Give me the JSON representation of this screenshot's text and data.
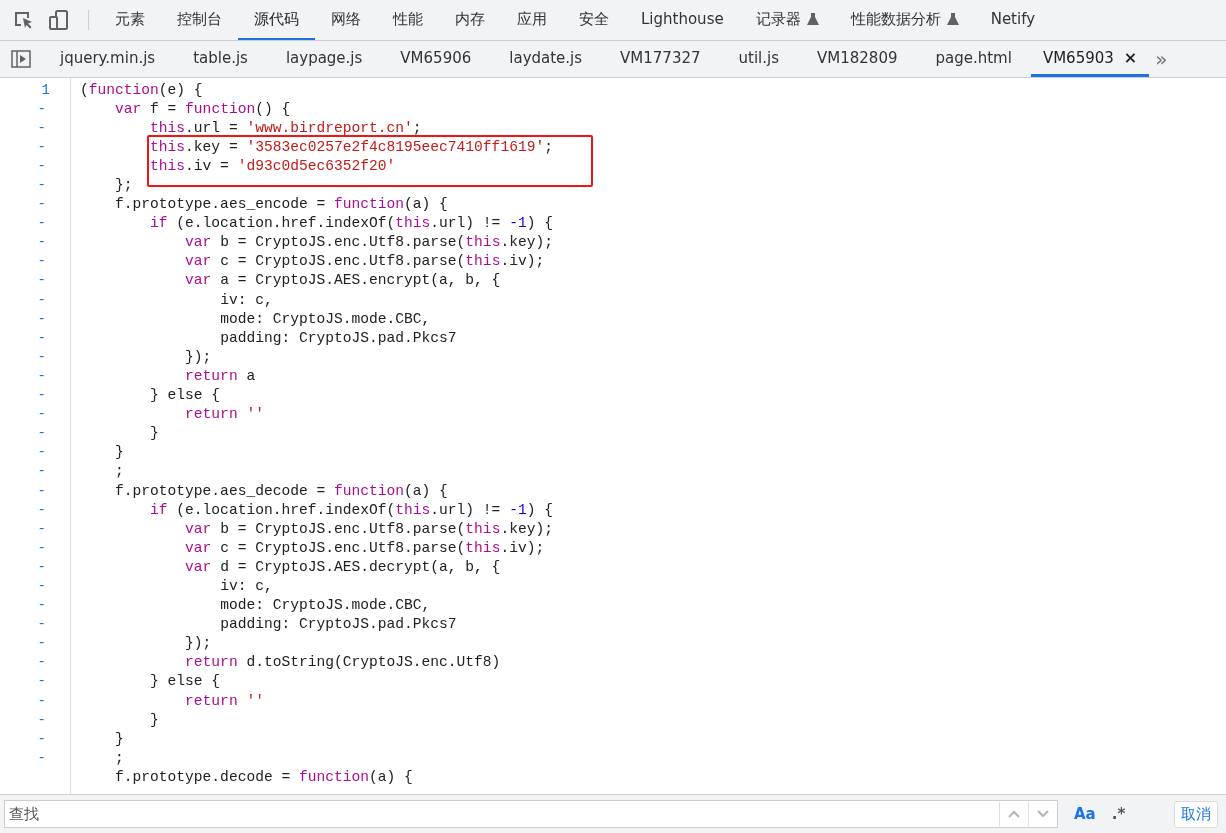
{
  "main_tabs": [
    {
      "label": "元素",
      "selected": false,
      "experimental": false
    },
    {
      "label": "控制台",
      "selected": false,
      "experimental": false
    },
    {
      "label": "源代码",
      "selected": true,
      "experimental": false
    },
    {
      "label": "网络",
      "selected": false,
      "experimental": false
    },
    {
      "label": "性能",
      "selected": false,
      "experimental": false
    },
    {
      "label": "内存",
      "selected": false,
      "experimental": false
    },
    {
      "label": "应用",
      "selected": false,
      "experimental": false
    },
    {
      "label": "安全",
      "selected": false,
      "experimental": false
    },
    {
      "label": "Lighthouse",
      "selected": false,
      "experimental": false
    },
    {
      "label": "记录器",
      "selected": false,
      "experimental": true
    },
    {
      "label": "性能数据分析",
      "selected": false,
      "experimental": true
    },
    {
      "label": "Netify",
      "selected": false,
      "experimental": false
    }
  ],
  "file_tabs": [
    {
      "label": "jquery.min.js",
      "selected": false
    },
    {
      "label": "table.js",
      "selected": false
    },
    {
      "label": "laypage.js",
      "selected": false
    },
    {
      "label": "VM65906",
      "selected": false
    },
    {
      "label": "laydate.js",
      "selected": false
    },
    {
      "label": "VM177327",
      "selected": false
    },
    {
      "label": "util.js",
      "selected": false
    },
    {
      "label": "VM182809",
      "selected": false
    },
    {
      "label": "page.html",
      "selected": false
    },
    {
      "label": "VM65903",
      "selected": true,
      "close": "×"
    }
  ],
  "overflow": "»",
  "code_lines": [
    {
      "gutter": "1",
      "segments": [
        {
          "kind": "plain",
          "text": "("
        },
        {
          "kind": "keyword",
          "text": "function"
        },
        {
          "kind": "plain",
          "text": "(e) {"
        }
      ]
    },
    {
      "gutter": "-",
      "segments": [
        {
          "kind": "keyword",
          "text": "    var"
        },
        {
          "kind": "plain",
          "text": " f = "
        },
        {
          "kind": "keyword",
          "text": "function"
        },
        {
          "kind": "plain",
          "text": "() {"
        }
      ]
    },
    {
      "gutter": "-",
      "segments": [
        {
          "kind": "keyword",
          "text": "        this"
        },
        {
          "kind": "plain",
          "text": ".url = "
        },
        {
          "kind": "string",
          "text": "'www.birdreport.cn'"
        },
        {
          "kind": "plain",
          "text": ";"
        }
      ]
    },
    {
      "gutter": "-",
      "boxed": true,
      "segments": [
        {
          "kind": "keyword",
          "text": "        this"
        },
        {
          "kind": "plain",
          "text": ".key = "
        },
        {
          "kind": "string",
          "text": "'3583ec0257e2f4c8195eec7410ff1619'"
        },
        {
          "kind": "plain",
          "text": ";"
        }
      ]
    },
    {
      "gutter": "-",
      "boxed": true,
      "segments": [
        {
          "kind": "keyword",
          "text": "        this"
        },
        {
          "kind": "plain",
          "text": ".iv = "
        },
        {
          "kind": "string",
          "text": "'d93c0d5ec6352f20'"
        }
      ]
    },
    {
      "gutter": "-",
      "segments": [
        {
          "kind": "plain",
          "text": "    };"
        }
      ]
    },
    {
      "gutter": "-",
      "segments": [
        {
          "kind": "plain",
          "text": "    f.prototype.aes_encode = "
        },
        {
          "kind": "keyword",
          "text": "function"
        },
        {
          "kind": "plain",
          "text": "(a) {"
        }
      ]
    },
    {
      "gutter": "-",
      "segments": [
        {
          "kind": "keyword",
          "text": "        if"
        },
        {
          "kind": "plain",
          "text": " (e.location.href.indexOf("
        },
        {
          "kind": "keyword",
          "text": "this"
        },
        {
          "kind": "plain",
          "text": ".url) != "
        },
        {
          "kind": "number",
          "text": "-1"
        },
        {
          "kind": "plain",
          "text": ") {"
        }
      ]
    },
    {
      "gutter": "-",
      "segments": [
        {
          "kind": "keyword",
          "text": "            var"
        },
        {
          "kind": "plain",
          "text": " b = CryptoJS.enc.Utf8.parse("
        },
        {
          "kind": "keyword",
          "text": "this"
        },
        {
          "kind": "plain",
          "text": ".key);"
        }
      ]
    },
    {
      "gutter": "-",
      "segments": [
        {
          "kind": "keyword",
          "text": "            var"
        },
        {
          "kind": "plain",
          "text": " c = CryptoJS.enc.Utf8.parse("
        },
        {
          "kind": "keyword",
          "text": "this"
        },
        {
          "kind": "plain",
          "text": ".iv);"
        }
      ]
    },
    {
      "gutter": "-",
      "segments": [
        {
          "kind": "keyword",
          "text": "            var"
        },
        {
          "kind": "plain",
          "text": " a = CryptoJS.AES.encrypt(a, b, {"
        }
      ]
    },
    {
      "gutter": "-",
      "segments": [
        {
          "kind": "plain",
          "text": "                iv: c,"
        }
      ]
    },
    {
      "gutter": "-",
      "segments": [
        {
          "kind": "plain",
          "text": "                mode: CryptoJS.mode.CBC,"
        }
      ]
    },
    {
      "gutter": "-",
      "segments": [
        {
          "kind": "plain",
          "text": "                padding: CryptoJS.pad.Pkcs7"
        }
      ]
    },
    {
      "gutter": "-",
      "segments": [
        {
          "kind": "plain",
          "text": "            });"
        }
      ]
    },
    {
      "gutter": "-",
      "segments": [
        {
          "kind": "keyword",
          "text": "            return"
        },
        {
          "kind": "plain",
          "text": " a"
        }
      ]
    },
    {
      "gutter": "-",
      "segments": [
        {
          "kind": "plain",
          "text": "        } else {"
        }
      ]
    },
    {
      "gutter": "-",
      "segments": [
        {
          "kind": "keyword",
          "text": "            return"
        },
        {
          "kind": "string",
          "text": " ''"
        }
      ]
    },
    {
      "gutter": "-",
      "segments": [
        {
          "kind": "plain",
          "text": "        }"
        }
      ]
    },
    {
      "gutter": "-",
      "segments": [
        {
          "kind": "plain",
          "text": "    }"
        }
      ]
    },
    {
      "gutter": "-",
      "segments": [
        {
          "kind": "plain",
          "text": "    ;"
        }
      ]
    },
    {
      "gutter": "-",
      "segments": [
        {
          "kind": "plain",
          "text": "    f.prototype.aes_decode = "
        },
        {
          "kind": "keyword",
          "text": "function"
        },
        {
          "kind": "plain",
          "text": "(a) {"
        }
      ]
    },
    {
      "gutter": "-",
      "segments": [
        {
          "kind": "keyword",
          "text": "        if"
        },
        {
          "kind": "plain",
          "text": " (e.location.href.indexOf("
        },
        {
          "kind": "keyword",
          "text": "this"
        },
        {
          "kind": "plain",
          "text": ".url) != "
        },
        {
          "kind": "number",
          "text": "-1"
        },
        {
          "kind": "plain",
          "text": ") {"
        }
      ]
    },
    {
      "gutter": "-",
      "segments": [
        {
          "kind": "keyword",
          "text": "            var"
        },
        {
          "kind": "plain",
          "text": " b = CryptoJS.enc.Utf8.parse("
        },
        {
          "kind": "keyword",
          "text": "this"
        },
        {
          "kind": "plain",
          "text": ".key);"
        }
      ]
    },
    {
      "gutter": "-",
      "segments": [
        {
          "kind": "keyword",
          "text": "            var"
        },
        {
          "kind": "plain",
          "text": " c = CryptoJS.enc.Utf8.parse("
        },
        {
          "kind": "keyword",
          "text": "this"
        },
        {
          "kind": "plain",
          "text": ".iv);"
        }
      ]
    },
    {
      "gutter": "-",
      "segments": [
        {
          "kind": "keyword",
          "text": "            var"
        },
        {
          "kind": "plain",
          "text": " d = CryptoJS.AES.decrypt(a, b, {"
        }
      ]
    },
    {
      "gutter": "-",
      "segments": [
        {
          "kind": "plain",
          "text": "                iv: c,"
        }
      ]
    },
    {
      "gutter": "-",
      "segments": [
        {
          "kind": "plain",
          "text": "                mode: CryptoJS.mode.CBC,"
        }
      ]
    },
    {
      "gutter": "-",
      "segments": [
        {
          "kind": "plain",
          "text": "                padding: CryptoJS.pad.Pkcs7"
        }
      ]
    },
    {
      "gutter": "-",
      "segments": [
        {
          "kind": "plain",
          "text": "            });"
        }
      ]
    },
    {
      "gutter": "-",
      "segments": [
        {
          "kind": "keyword",
          "text": "            return"
        },
        {
          "kind": "plain",
          "text": " d.toString(CryptoJS.enc.Utf8)"
        }
      ]
    },
    {
      "gutter": "-",
      "segments": [
        {
          "kind": "plain",
          "text": "        } else {"
        }
      ]
    },
    {
      "gutter": "-",
      "segments": [
        {
          "kind": "keyword",
          "text": "            return"
        },
        {
          "kind": "string",
          "text": " ''"
        }
      ]
    },
    {
      "gutter": "-",
      "segments": [
        {
          "kind": "plain",
          "text": "        }"
        }
      ]
    },
    {
      "gutter": "-",
      "segments": [
        {
          "kind": "plain",
          "text": "    }"
        }
      ]
    },
    {
      "gutter": "-",
      "segments": [
        {
          "kind": "plain",
          "text": "    ;"
        }
      ]
    },
    {
      "segments": [
        {
          "kind": "plain",
          "text": "    f.prototype.decode = "
        },
        {
          "kind": "keyword",
          "text": "function"
        },
        {
          "kind": "plain",
          "text": "(a) {"
        }
      ]
    }
  ],
  "search": {
    "placeholder": "查找",
    "match_case": "Aa",
    "regex": ".*",
    "cancel": "取消"
  }
}
